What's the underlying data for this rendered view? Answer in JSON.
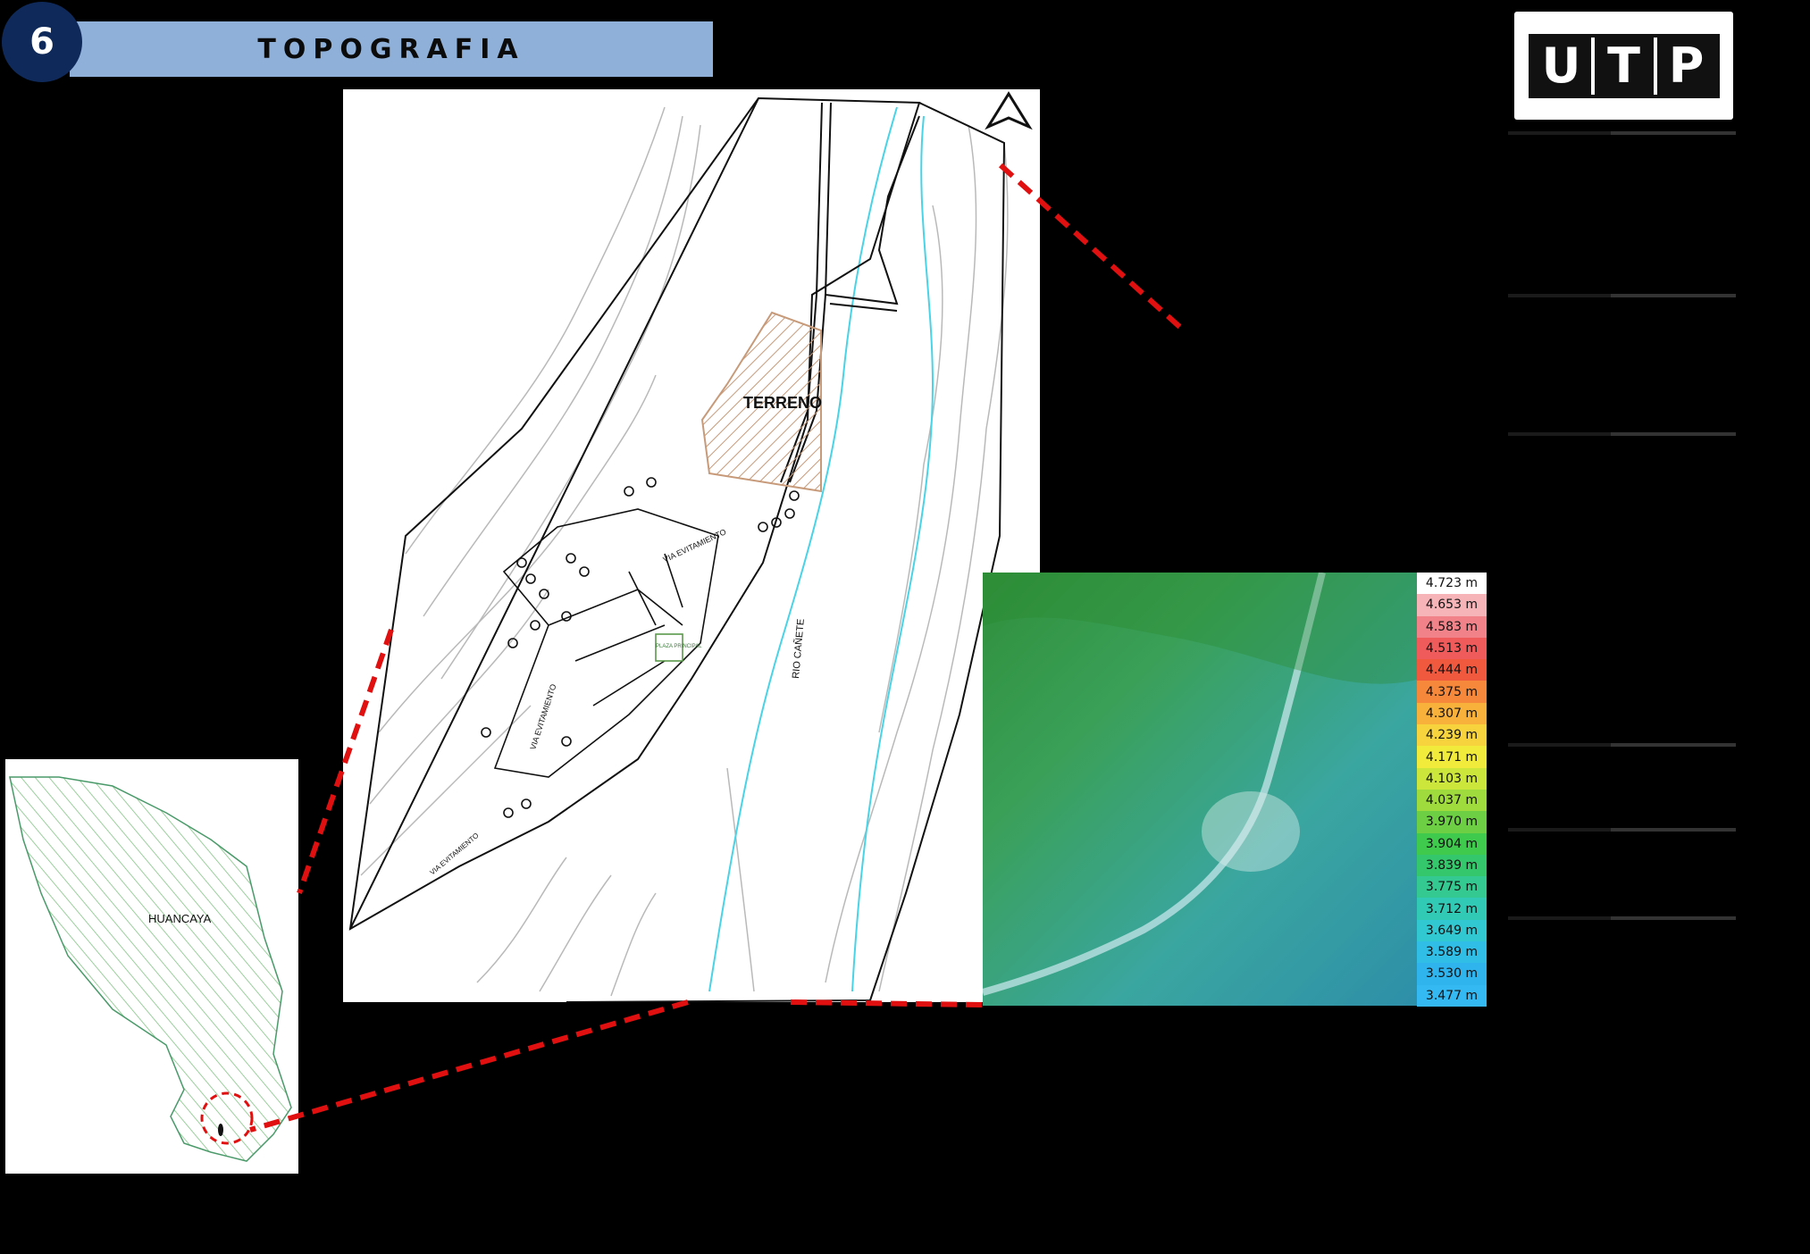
{
  "header": {
    "badge_number": "6",
    "title": "TOPOGRAFIA"
  },
  "logo": {
    "letters": [
      "U",
      "T",
      "P"
    ]
  },
  "map": {
    "terrain_label": "TERRENO",
    "river_label": "RIO CAÑETE",
    "street_labels": [
      "VIA EVITAMIENTO",
      "VIA EVITAMIENTO",
      "VIA EVITAMIENTO"
    ],
    "plaza_label": "PLAZA PRINCIPAL"
  },
  "region": {
    "label": "HUANCAYA"
  },
  "elevation_legend": {
    "items": [
      {
        "label": "4.723 m",
        "color": "#ffffff"
      },
      {
        "label": "4.653 m",
        "color": "#f6b3b8"
      },
      {
        "label": "4.583 m",
        "color": "#f18289"
      },
      {
        "label": "4.513 m",
        "color": "#ef5a5a"
      },
      {
        "label": "4.444 m",
        "color": "#f0593e"
      },
      {
        "label": "4.375 m",
        "color": "#f5883a"
      },
      {
        "label": "4.307 m",
        "color": "#f8b13a"
      },
      {
        "label": "4.239 m",
        "color": "#f7d43e"
      },
      {
        "label": "4.171 m",
        "color": "#f1ec3b"
      },
      {
        "label": "4.103 m",
        "color": "#cde63b"
      },
      {
        "label": "4.037 m",
        "color": "#9fdb3d"
      },
      {
        "label": "3.970 m",
        "color": "#6dd044"
      },
      {
        "label": "3.904 m",
        "color": "#3fca4e"
      },
      {
        "label": "3.839 m",
        "color": "#35c76b"
      },
      {
        "label": "3.775 m",
        "color": "#33c991"
      },
      {
        "label": "3.712 m",
        "color": "#31cbb5"
      },
      {
        "label": "3.649 m",
        "color": "#31c8d2"
      },
      {
        "label": "3.589 m",
        "color": "#30bde6"
      },
      {
        "label": "3.530 m",
        "color": "#2fb4ee"
      },
      {
        "label": "3.477 m",
        "color": "#35b9f2"
      }
    ]
  }
}
